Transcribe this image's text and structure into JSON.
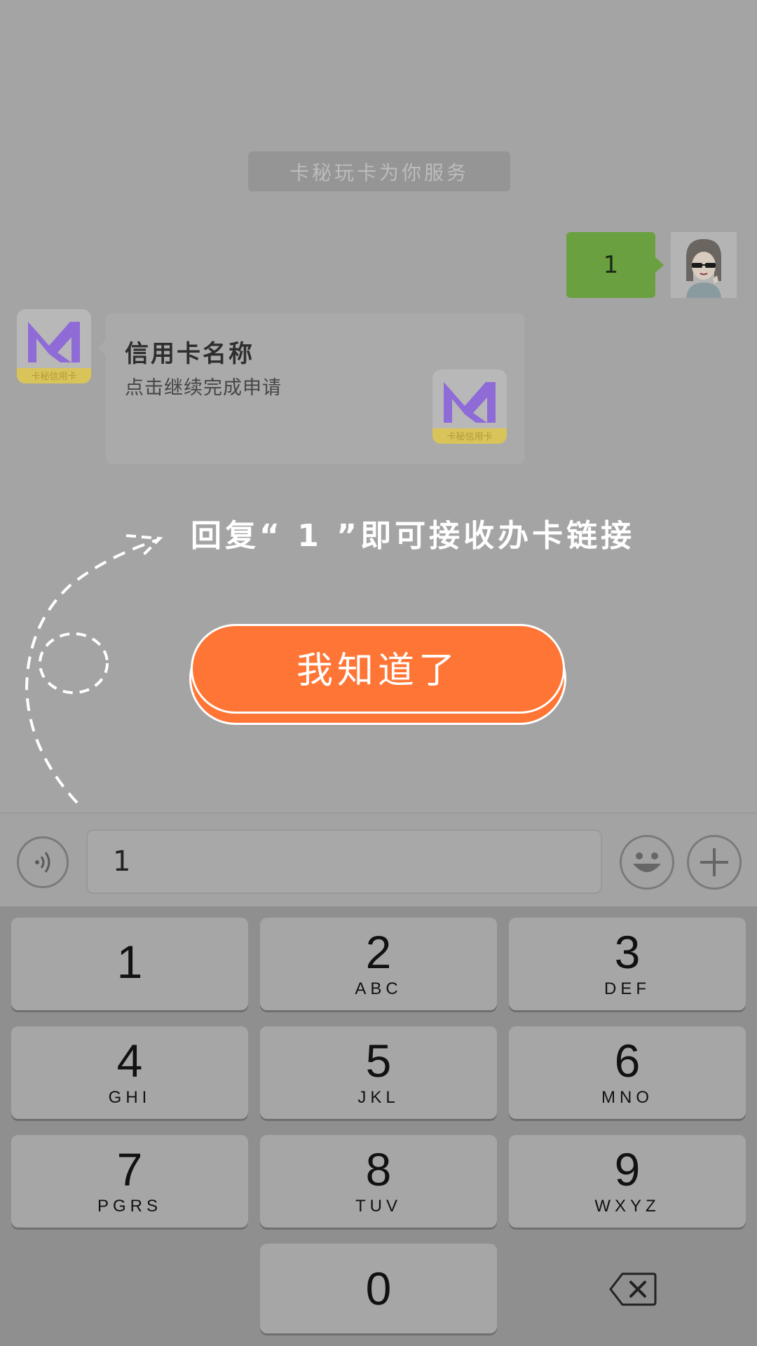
{
  "chat": {
    "system_notice": "卡秘玩卡为你服务",
    "user_message": "1",
    "card": {
      "title": "信用卡名称",
      "subtitle": "点击继续完成申请",
      "logo_text": "卡秘信用卡"
    }
  },
  "overlay": {
    "hint": "回复“ 1 ”即可接收办卡链接",
    "ok_button": "我知道了"
  },
  "input_bar": {
    "value": "1",
    "left_icon": "voice-icon",
    "emoji_icon": "emoji-icon",
    "plus_icon": "plus-icon"
  },
  "keypad": {
    "keys": [
      {
        "num": "1",
        "letters": ""
      },
      {
        "num": "2",
        "letters": "ABC"
      },
      {
        "num": "3",
        "letters": "DEF"
      },
      {
        "num": "4",
        "letters": "GHI"
      },
      {
        "num": "5",
        "letters": "JKL"
      },
      {
        "num": "6",
        "letters": "MNO"
      },
      {
        "num": "7",
        "letters": "PGRS"
      },
      {
        "num": "8",
        "letters": "TUV"
      },
      {
        "num": "9",
        "letters": "WXYZ"
      },
      {
        "num": "0",
        "letters": ""
      }
    ],
    "backspace_icon": "backspace-icon"
  },
  "colors": {
    "background": "#a4a4a4",
    "user_bubble": "#6aa03f",
    "ok_button": "#ff7535",
    "logo_purple": "#8a63d2",
    "logo_yellow": "#e0c95a"
  }
}
